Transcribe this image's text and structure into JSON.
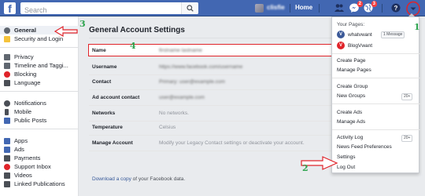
{
  "topbar": {
    "logo": "f",
    "search_placeholder": "Search",
    "user_name": "clisfie",
    "home": "Home",
    "badges": {
      "friends": "",
      "messages": "2",
      "notifications": "3"
    }
  },
  "sidebar": {
    "items": [
      {
        "label": "General",
        "color": "#606770",
        "active": true
      },
      {
        "label": "Security and Login",
        "color": "#f5c33b",
        "active": false
      },
      {
        "label": "Privacy",
        "color": "#606770"
      },
      {
        "label": "Timeline and Taggi...",
        "color": "#606770"
      },
      {
        "label": "Blocking",
        "color": "#e0242a"
      },
      {
        "label": "Language",
        "color": "#4b4f56"
      },
      {
        "label": "Notifications",
        "color": "#4b4f56"
      },
      {
        "label": "Mobile",
        "color": "#4b4f56"
      },
      {
        "label": "Public Posts",
        "color": "#4267b2"
      },
      {
        "label": "Apps",
        "color": "#4267b2"
      },
      {
        "label": "Ads",
        "color": "#4267b2"
      },
      {
        "label": "Payments",
        "color": "#4b4f56"
      },
      {
        "label": "Support Inbox",
        "color": "#e0242a"
      },
      {
        "label": "Videos",
        "color": "#4b4f56"
      },
      {
        "label": "Linked Publications",
        "color": "#4b4f56"
      }
    ]
  },
  "main": {
    "title": "General Account Settings",
    "rows": [
      {
        "label": "Name",
        "value": "firstname lastname",
        "blurred": true
      },
      {
        "label": "Username",
        "value": "https://www.facebook.com/username",
        "blurred": true
      },
      {
        "label": "Contact",
        "value": "Primary: user@example.com",
        "blurred": true
      },
      {
        "label": "Ad account contact",
        "value": "user@example.com",
        "blurred": true
      },
      {
        "label": "Networks",
        "value": "No networks.",
        "blurred": false
      },
      {
        "label": "Temperature",
        "value": "Celsius",
        "blurred": false
      },
      {
        "label": "Manage Account",
        "value": "Modify your Legacy Contact settings or deactivate your account.",
        "blurred": false
      }
    ],
    "download_link": "Download a copy",
    "download_suffix": " of your Facebook data."
  },
  "menu": {
    "your_pages": "Your Pages:",
    "pages": [
      {
        "name": "whatvwant",
        "logo": "V",
        "color": "#3b5998",
        "badge": "1 Message"
      },
      {
        "name": "BlogVwant",
        "logo": "V",
        "color": "#e0242a",
        "badge": ""
      }
    ],
    "groups": [
      [
        "Create Page",
        "Manage Pages"
      ],
      [
        "Create Group",
        "New Groups"
      ],
      [
        "Create Ads",
        "Manage Ads"
      ],
      [
        "Activity Log",
        "News Feed Preferences",
        "Settings",
        "Log Out"
      ]
    ],
    "new_groups_badge": "20+",
    "activity_badge": "20+"
  },
  "annotations": [
    "1",
    "2",
    "3",
    "4"
  ],
  "colors": {
    "brand": "#4267b2",
    "annotation_green": "#2ea44f",
    "annotation_red": "#e0242a"
  }
}
